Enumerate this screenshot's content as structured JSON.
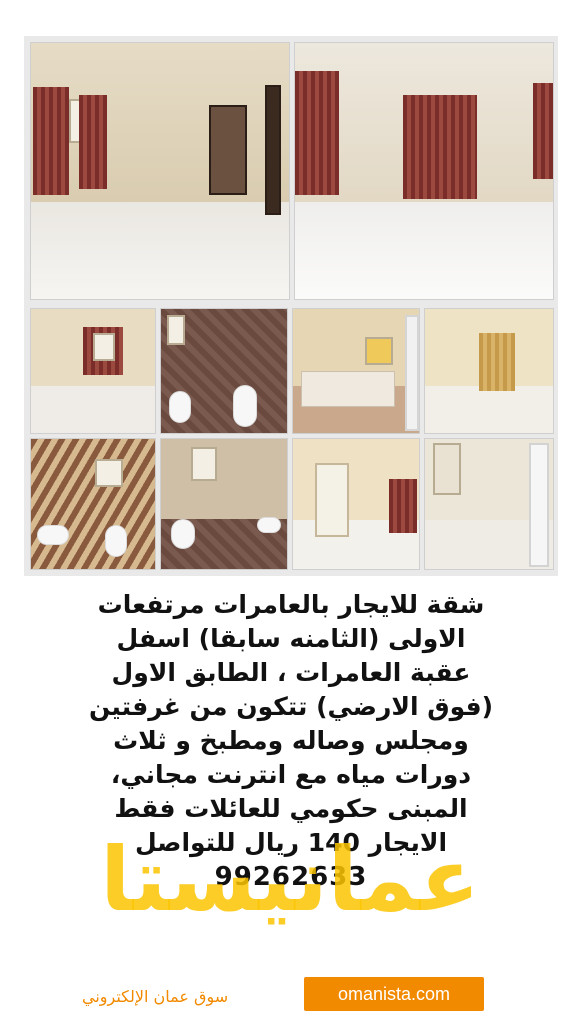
{
  "caption_lines": [
    "شقة للايجار بالعامرات مرتفعات",
    "الاولى (الثامنه سابقا) اسفل",
    "عقبة العامرات ، الطابق الاول",
    "(فوق الارضي) تتكون من غرفتين",
    "ومجلس وصاله ومطبخ و ثلاث",
    "دورات مياه مع انترنت مجاني،",
    "المبنى حكومي للعائلات فقط",
    "الايجار 140 ريال للتواصل"
  ],
  "phone": "99262633",
  "watermark": "عمانيستا",
  "footer": {
    "site_name_ar": "سوق عمان الإلكتروني",
    "url": "omanista.com"
  },
  "colors": {
    "accent": "#f28a00",
    "watermark": "#fac400"
  }
}
